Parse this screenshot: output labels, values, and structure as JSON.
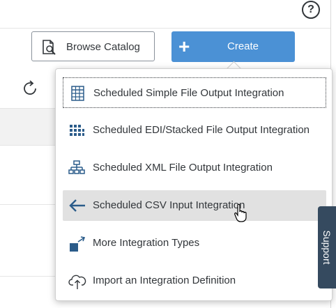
{
  "header": {
    "help_glyph": "?"
  },
  "toolbar": {
    "browse_catalog_label": "Browse Catalog",
    "create_label": "Create",
    "create_glyph": "+"
  },
  "menu": {
    "items": [
      {
        "label": "Scheduled Simple File Output Integration",
        "icon": "table-grid-icon"
      },
      {
        "label": "Scheduled EDI/Stacked File Output Integration",
        "icon": "stacked-blocks-icon"
      },
      {
        "label": "Scheduled XML File Output Integration",
        "icon": "hierarchy-icon"
      },
      {
        "label": "Scheduled CSV Input Integration",
        "icon": "arrow-left-icon"
      },
      {
        "label": "More Integration Types",
        "icon": "box-arrow-out-icon"
      },
      {
        "label": "Import an Integration Definition",
        "icon": "cloud-upload-icon"
      }
    ]
  },
  "support": {
    "label": "Support"
  },
  "colors": {
    "accent": "#4b91d5",
    "icon_blue": "#2b5c8a",
    "support_bg": "#354a5f"
  }
}
